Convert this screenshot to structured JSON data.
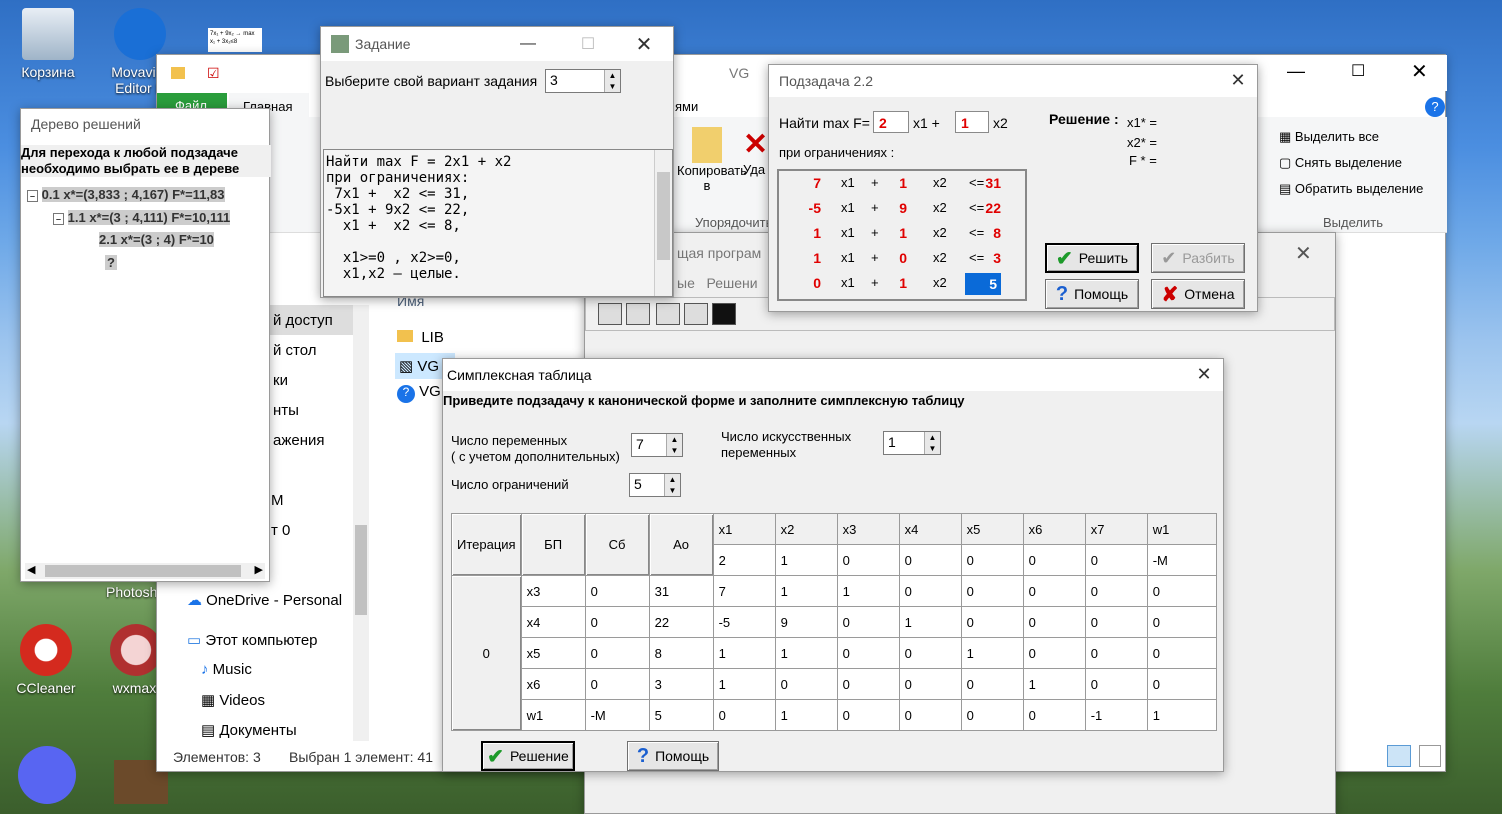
{
  "desktop": {
    "icons": [
      "Корзина",
      "Movavi V\nEditor P",
      "CCleaner",
      "wxmaxi",
      "Photosh"
    ],
    "snippet": "7x₁ + 9x₂ → max\nx₁ + 3x₂≤8"
  },
  "explorer": {
    "title": "VG",
    "tabs": [
      "Файл",
      "Главная"
    ],
    "ribbon": {
      "copy": "Копи",
      "paste": "Копировать\nв",
      "delete": "Уда",
      "group_organize": "Упорядочить",
      "select_all": "Выделить все",
      "deselect": "Снять выделение",
      "invert": "Обратить выделение",
      "group_select": "Выделить",
      "mass": "ями"
    },
    "nav": [
      "й доступ",
      "й стол",
      "ки",
      "нты",
      "ажения",
      "M",
      "т 0"
    ],
    "onedrive": "OneDrive - Personal",
    "pc": "Этот компьютер",
    "music": "Music",
    "videos": "Videos",
    "docs": "Документы",
    "col_name": "Имя",
    "files": [
      "LIB",
      "VG",
      "VG"
    ],
    "status_count": "Элементов: 3",
    "status_sel": "Выбран 1 элемент: 41"
  },
  "prog": {
    "title": "щая програм",
    "menu": [
      "ые",
      "Решени"
    ]
  },
  "tree": {
    "title": "Дерево решений",
    "header1": "Для перехода к любой подзадаче",
    "header2": "необходимо выбрать ее в дереве",
    "n1": "0.1  x*=(3,833 ; 4,167) F*=11,83",
    "n2": "1.1  x*=(3 ; 4,111) F*=10,111",
    "n3": "2.1  x*=(3 ; 4) F*=10",
    "n4": "?"
  },
  "task": {
    "title": "Задание",
    "variant_label": "Выберите свой вариант задания",
    "variant": "3",
    "text": "Найти max F = 2x1 + x2\nпри ограничениях:\n 7x1 +  x2 <= 31,\n-5x1 + 9x2 <= 22,\n  x1 +  x2 <= 8,\n\n  x1>=0 , x2>=0,\n  x1,x2 – целые."
  },
  "sub": {
    "title": "Подзадача 2.2",
    "find": "Найти  max F=",
    "c1": "2",
    "x1": "x1  +",
    "c2": "1",
    "x2": "x2",
    "cons_label": "при ограничениях  :",
    "solution": "Решение :",
    "x1s": "x1* =",
    "x2s": "x2* =",
    "fs": "F * =",
    "rows": [
      [
        "7",
        "x1",
        "+",
        "1",
        "x2",
        "<=",
        "31"
      ],
      [
        "-5",
        "x1",
        "+",
        "9",
        "x2",
        "<=",
        "22"
      ],
      [
        "1",
        "x1",
        "+",
        "1",
        "x2",
        "<=",
        "8"
      ],
      [
        "1",
        "x1",
        "+",
        "0",
        "x2",
        "<=",
        "3"
      ],
      [
        "0",
        "x1",
        "+",
        "1",
        "x2",
        ">=",
        "5"
      ]
    ],
    "btn_solve": "Решить",
    "btn_split": "Разбить",
    "btn_help": "Помощь",
    "btn_cancel": "Отмена"
  },
  "simplex": {
    "title": "Симплексная таблица",
    "instr": "Приведите подзадачу к канонической форме и заполните симплексную  таблицу",
    "nvars_label1": "Число переменных",
    "nvars_label2": "( с учетом дополнительных)",
    "nvars": "7",
    "ncons_label": "Число ограничений",
    "ncons": "5",
    "nart_label1": "Число искусственных",
    "nart_label2": "переменных",
    "nart": "1",
    "hdr": [
      "Итерация",
      "БП",
      "Сб",
      "Ао"
    ],
    "vars": [
      "x1",
      "x2",
      "x3",
      "x4",
      "x5",
      "x6",
      "x7",
      "w1"
    ],
    "coef": [
      "2",
      "1",
      "0",
      "0",
      "0",
      "0",
      "0",
      "-M"
    ],
    "iter": "0",
    "rows": [
      [
        "x3",
        "0",
        "31",
        "7",
        "1",
        "1",
        "0",
        "0",
        "0",
        "0",
        "0"
      ],
      [
        "x4",
        "0",
        "22",
        "-5",
        "9",
        "0",
        "1",
        "0",
        "0",
        "0",
        "0"
      ],
      [
        "x5",
        "0",
        "8",
        "1",
        "1",
        "0",
        "0",
        "1",
        "0",
        "0",
        "0"
      ],
      [
        "x6",
        "0",
        "3",
        "1",
        "0",
        "0",
        "0",
        "0",
        "1",
        "0",
        "0"
      ],
      [
        "w1",
        "-M",
        "5",
        "0",
        "1",
        "0",
        "0",
        "0",
        "0",
        "-1",
        "1"
      ]
    ],
    "btn_solution": "Решение",
    "btn_help": "Помощь"
  }
}
